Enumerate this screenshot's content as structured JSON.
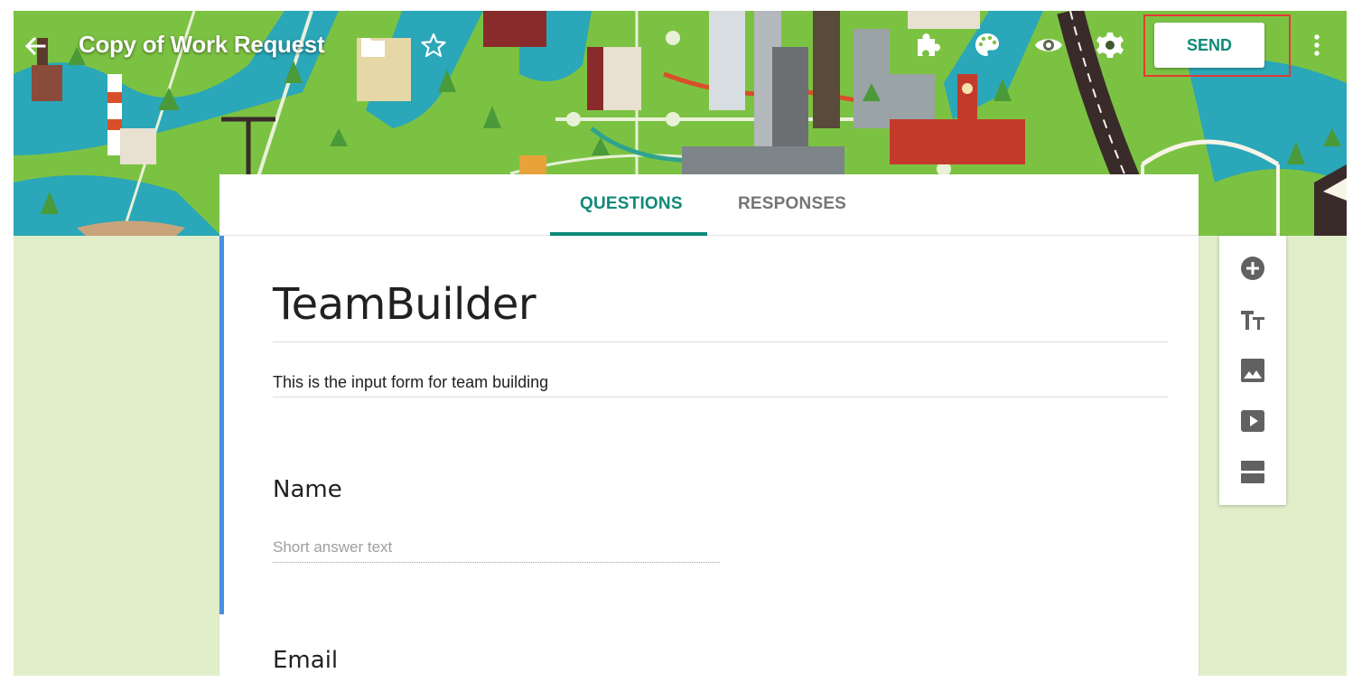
{
  "header": {
    "title": "Copy of Work Request",
    "send_label": "SEND",
    "icons": [
      "back-arrow-icon",
      "folder-icon",
      "star-icon",
      "addon-puzzle-icon",
      "palette-icon",
      "preview-eye-icon",
      "settings-gear-icon",
      "more-vert-icon"
    ]
  },
  "tabs": [
    {
      "label": "QUESTIONS",
      "active": true
    },
    {
      "label": "RESPONSES",
      "active": false
    }
  ],
  "form": {
    "title": "TeamBuilder",
    "description": "This is the input form for team building",
    "questions": [
      {
        "label": "Name",
        "answer_placeholder": "Short answer text"
      },
      {
        "label": "Email"
      }
    ]
  },
  "side_toolbar": {
    "icons": [
      "add-question-icon",
      "add-title-icon",
      "add-image-icon",
      "add-video-icon",
      "add-section-icon"
    ]
  },
  "colors": {
    "accent": "#0f8a78",
    "page_background": "#e0efca",
    "form_accent_bar": "#4a90e2",
    "send_highlight": "#e53935"
  }
}
